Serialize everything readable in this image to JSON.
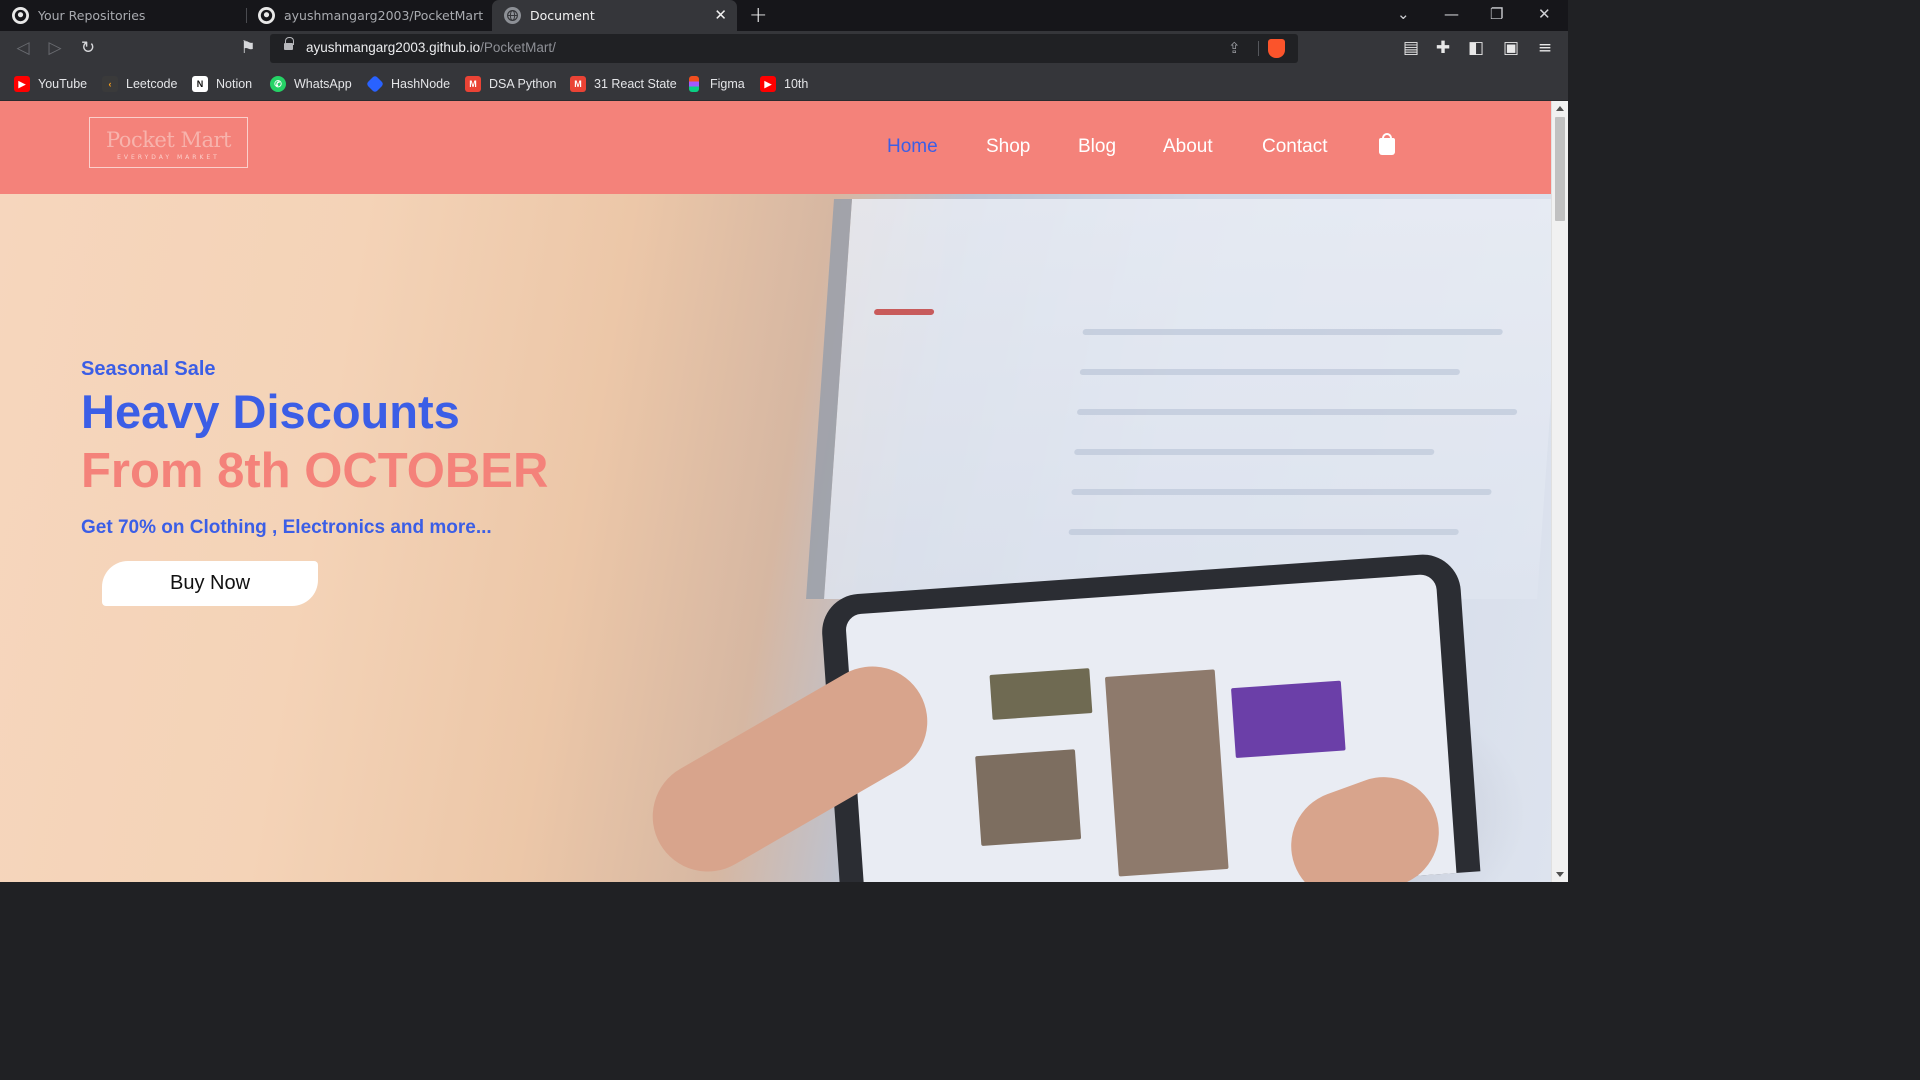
{
  "browser": {
    "tabs": [
      {
        "title": "Your Repositories",
        "icon": "github-icon",
        "active": false
      },
      {
        "title": "ayushmangarg2003/PocketMart",
        "icon": "github-icon",
        "active": false
      },
      {
        "title": "Document",
        "icon": "globe-icon",
        "active": true
      }
    ],
    "address": {
      "host": "ayushmangarg2003.github.io",
      "path": "/PocketMart/"
    },
    "bookmarks": [
      {
        "label": "YouTube",
        "icon": "youtube-icon",
        "color": "#ff0000"
      },
      {
        "label": "Leetcode",
        "icon": "leetcode-icon",
        "color": "#f89f1b"
      },
      {
        "label": "Notion",
        "icon": "notion-icon",
        "color": "#ffffff"
      },
      {
        "label": "WhatsApp",
        "icon": "whatsapp-icon",
        "color": "#25d366"
      },
      {
        "label": "HashNode",
        "icon": "hashnode-icon",
        "color": "#2962ff"
      },
      {
        "label": "DSA Python",
        "icon": "gmail-icon",
        "color": "#ea4335"
      },
      {
        "label": "31 React State",
        "icon": "gmail-icon",
        "color": "#ea4335"
      },
      {
        "label": "Figma",
        "icon": "figma-icon",
        "color": "#a259ff"
      },
      {
        "label": "10th",
        "icon": "youtube-icon",
        "color": "#ff0000"
      }
    ]
  },
  "site": {
    "logo": {
      "name": "Pocket Mart",
      "tagline": "EVERYDAY MARKET"
    },
    "nav": [
      "Home",
      "Shop",
      "Blog",
      "About",
      "Contact"
    ],
    "active_nav": "Home",
    "colors": {
      "accent": "#f4827a",
      "brand_blue": "#3b5ee6"
    }
  },
  "hero": {
    "eyebrow": "Seasonal Sale",
    "headline_1": "Heavy Discounts",
    "headline_2": "From 8th OCTOBER",
    "subtext": "Get 70% on Clothing , Electronics and more...",
    "cta": "Buy Now"
  }
}
